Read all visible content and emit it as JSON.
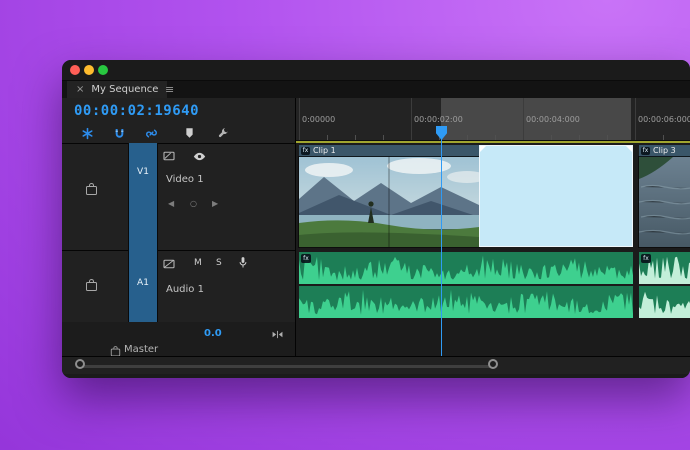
{
  "tab": {
    "close_label": "×",
    "title": "My Sequence",
    "menu_label": "≡"
  },
  "timeline": {
    "timecode": "00:00:02:19640",
    "ruler_ticks": [
      "0:00000",
      "00:00:02:00",
      "00:00:04:000",
      "00:00:06:000"
    ]
  },
  "toolbar": {
    "buttons": [
      "nest-icon",
      "snap-magnet-icon",
      "linked-selection-icon",
      "add-marker-icon",
      "timeline-settings-wrench-icon"
    ]
  },
  "tracks": {
    "video": {
      "id": "V1",
      "name": "Video 1",
      "kf_prev": "◀",
      "kf_add": "○",
      "kf_next": "▶"
    },
    "audio": {
      "id": "A1",
      "name": "Audio 1",
      "mute_label": "M",
      "solo_label": "S"
    },
    "master": {
      "name": "Master",
      "level": "0.0"
    }
  },
  "clips": {
    "clip1": {
      "badge": "fx",
      "label": "Clip 1"
    },
    "clip3": {
      "badge": "fx",
      "label": "Clip 3"
    },
    "audio1": {
      "badge": "fx"
    },
    "audio3": {
      "badge": "fx"
    }
  },
  "colors": {
    "accent_blue": "#2f9bf5",
    "traffic_close": "#ff5f57",
    "traffic_minimize": "#febc2e",
    "traffic_zoom": "#28c840",
    "audio_clip_green": "#1d7e56",
    "waveform_green": "#3ed08f",
    "selected_clip_blue": "#c6e9f8",
    "render_bar_yellow": "#a0a52f"
  }
}
